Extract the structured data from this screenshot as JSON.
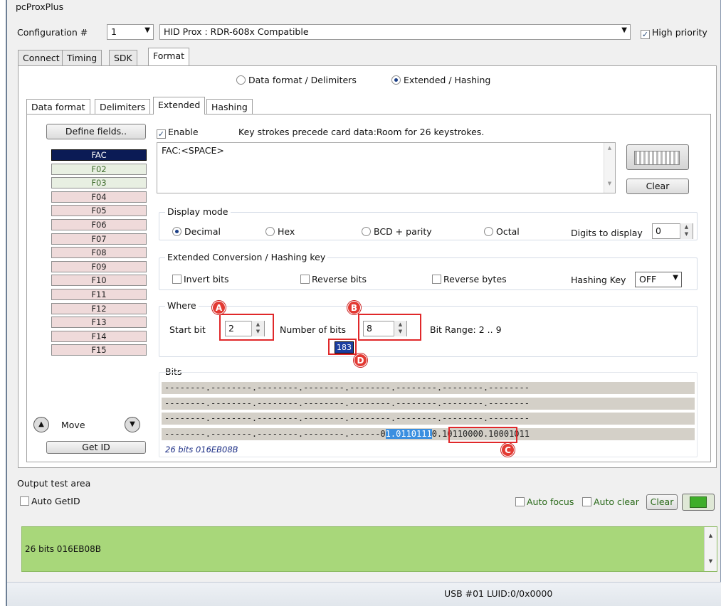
{
  "app": {
    "title": "pcProxPlus"
  },
  "config": {
    "label": "Configuration #",
    "number": "1",
    "device": "HID Prox : RDR-608x Compatible",
    "high_priority_label": "High priority",
    "high_priority_checked": true
  },
  "main_tabs": [
    "Connect",
    "Timing",
    "SDK",
    "Format"
  ],
  "mode_radio": {
    "option1": "Data format / Delimiters",
    "option2": "Extended / Hashing",
    "selected": "Extended / Hashing"
  },
  "sub_tabs": [
    "Data format",
    "Delimiters",
    "Extended",
    "Hashing"
  ],
  "define_fields_label": "Define fields..",
  "fields": [
    "FAC",
    "F02",
    "F03",
    "F04",
    "F05",
    "F06",
    "F07",
    "F08",
    "F09",
    "F10",
    "F11",
    "F12",
    "F13",
    "F14",
    "F15"
  ],
  "move_label": "Move",
  "get_id_label": "Get ID",
  "keystrokes": {
    "enable_label": "Enable",
    "info": "Key strokes precede card data:Room for 26 keystrokes.",
    "text": "FAC:<SPACE>",
    "clear_label": "Clear"
  },
  "display_mode": {
    "title": "Display mode",
    "options": [
      "Decimal",
      "Hex",
      "BCD + parity",
      "Octal"
    ],
    "selected": "Decimal",
    "digits_label": "Digits to display",
    "digits_value": "0"
  },
  "conversion": {
    "title": "Extended Conversion / Hashing key",
    "invert_label": "Invert bits",
    "reverse_bits_label": "Reverse bits",
    "reverse_bytes_label": "Reverse bytes",
    "hashing_key_label": "Hashing Key",
    "hashing_key_value": "OFF"
  },
  "where": {
    "title": "Where",
    "start_bit_label": "Start bit",
    "start_bit_value": "2",
    "num_bits_label": "Number of bits",
    "num_bits_value": "8",
    "bit_range": "Bit Range: 2 .. 9",
    "result": "183"
  },
  "bits": {
    "title": "Bits",
    "rows": [
      "--------.--------.--------.--------.--------.--------.--------.--------",
      "--------.--------.--------.--------.--------.--------.--------.--------",
      "--------.--------.--------.--------.--------.--------.--------.--------"
    ],
    "last_prefix": "--------.--------.--------.--------.------0",
    "last_highlight": "1.0110111",
    "last_suffix": "0.10110000.10001011",
    "summary": "26 bits 016EB08B"
  },
  "markers": [
    "A",
    "B",
    "C",
    "D"
  ],
  "output": {
    "title": "Output test area",
    "auto_getid_label": "Auto GetID",
    "auto_focus_label": "Auto focus",
    "auto_clear_label": "Auto clear",
    "clear_label": "Clear",
    "text": "26 bits 016EB08B"
  },
  "status": {
    "text": "USB #01 LUID:0/0x0000"
  },
  "colors": {
    "output_bg": "#a8d77a",
    "selected_field": "#0b1b55",
    "highlight": "#3b8fe0",
    "marker": "#e33a33"
  }
}
